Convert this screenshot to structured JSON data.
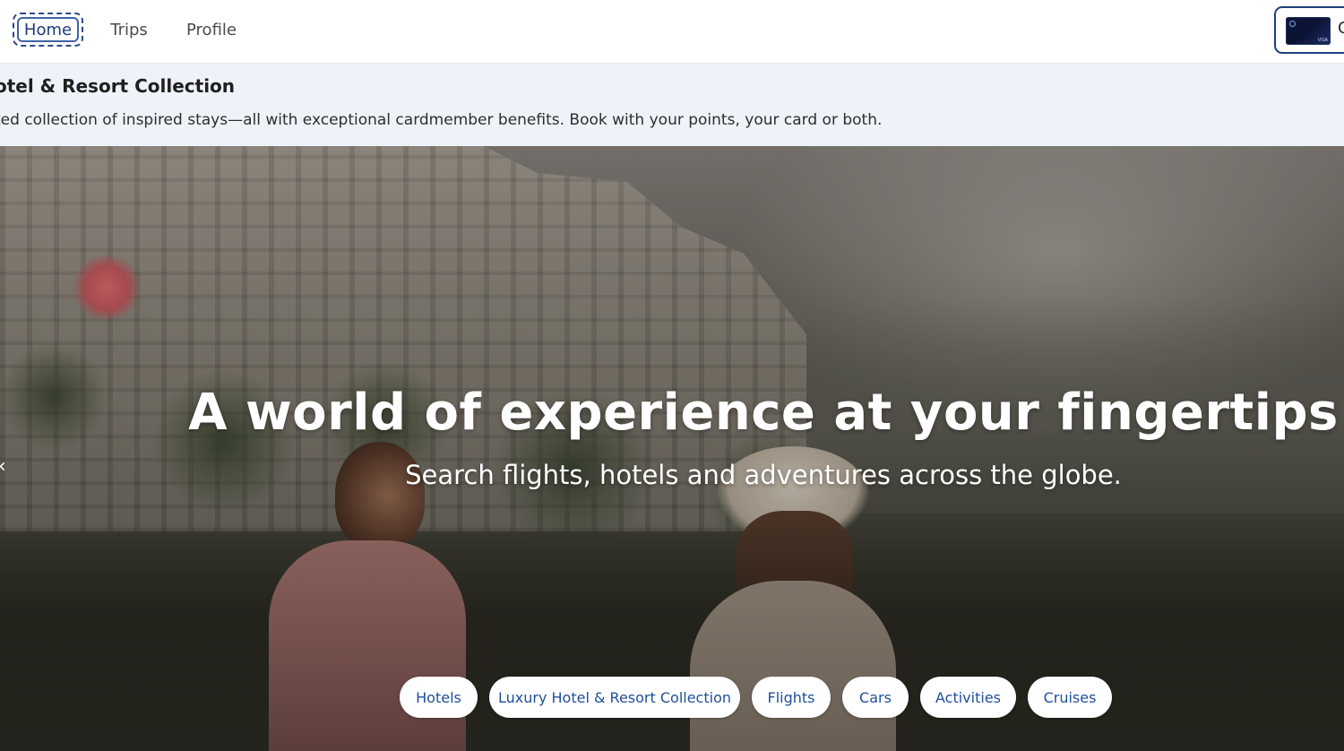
{
  "nav": {
    "tabs": [
      {
        "label": "Home",
        "active": true
      },
      {
        "label": "Trips"
      },
      {
        "label": "Profile"
      }
    ],
    "card_label": "C"
  },
  "banner": {
    "title": "otel & Resort Collection",
    "text": "ted collection of inspired stays—all with exceptional cardmember benefits. Book with your points, your card or both."
  },
  "hero": {
    "title": "A world of experience at your fingertips",
    "subtitle": "Search flights, hotels and adventures across the globe.",
    "prev_glyph": "‹"
  },
  "categories": [
    {
      "label": "Hotels"
    },
    {
      "label": "Luxury Hotel & Resort Collection"
    },
    {
      "label": "Flights"
    },
    {
      "label": "Cars"
    },
    {
      "label": "Activities"
    },
    {
      "label": "Cruises"
    }
  ],
  "colors": {
    "brand_navy": "#1f3f7c",
    "pill_text": "#1f4f9a",
    "banner_bg": "#eef2f9"
  }
}
